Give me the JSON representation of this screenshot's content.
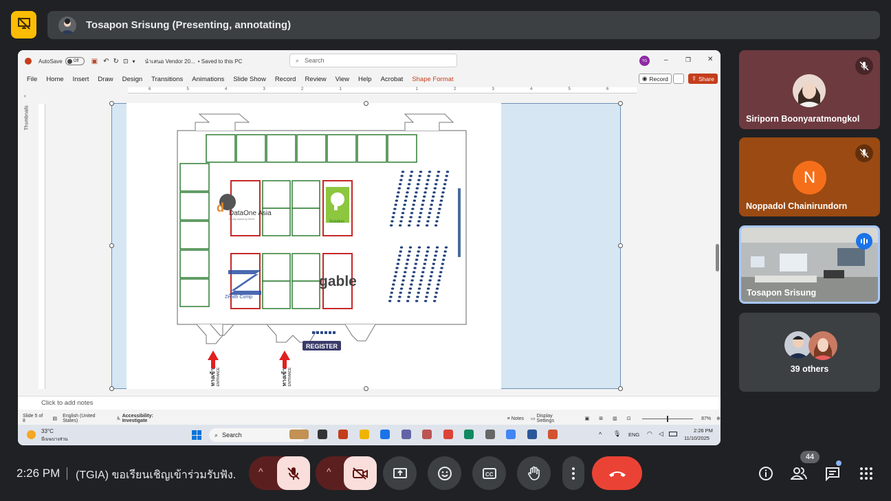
{
  "presenter": {
    "label": "Tosapon Srisung (Presenting, annotating)"
  },
  "ppt": {
    "autosave": "AutoSave",
    "autosave_state": "Off",
    "filename": "นำเสนอ Vendor 20...",
    "saved": "• Saved to this PC",
    "search_placeholder": "Search",
    "user_initials": "TG",
    "menu": [
      "File",
      "Home",
      "Insert",
      "Draw",
      "Design",
      "Transitions",
      "Animations",
      "Slide Show",
      "Record",
      "Review",
      "View",
      "Help",
      "Acrobat",
      "Shape Format"
    ],
    "record_label": "Record",
    "share_label": "Share",
    "thumbnails_label": "Thumbnails",
    "notes_placeholder": "Click to add notes",
    "status": {
      "slide": "Slide 5 of 8",
      "language": "English (United States)",
      "accessibility": "Accessibility: Investigate",
      "notes": "Notes",
      "display": "Display Settings",
      "zoom": "87%"
    },
    "taskbar": {
      "weather_temp": "33°C",
      "weather_desc": "มีเมฆบางส่วน",
      "search": "Search",
      "lang": "ENG",
      "time": "2:26 PM",
      "date": "11/10/2025"
    }
  },
  "slide": {
    "logos": {
      "dataone": "DataOne Asia",
      "dataone_sub": "Wholly owned by SUGA",
      "solution": "Solution",
      "zenith": "Zenith Comp",
      "gable": "gable",
      "register": "REGISTER",
      "entrance_th": "ทางเข้า",
      "entrance_en": "ENTRANCE"
    }
  },
  "participants": [
    {
      "name": "Siriporn Boonyaratmongkol",
      "bg": "#6d3a3f",
      "muted": true
    },
    {
      "name": "Noppadol Chainirundorn",
      "bg": "#9a4a12",
      "initial": "N",
      "muted": true
    },
    {
      "name": "Tosapon Srisung",
      "speaking": true
    },
    {
      "name": "39 others"
    }
  ],
  "bottombar": {
    "time": "2:26 PM",
    "meeting_title": "(TGIA) ขอเรียนเชิญเข้าร่วมรับฟัง...",
    "people_count": "44"
  },
  "colors": {
    "end_call": "#ea4335",
    "muted_btn": "#f9dedc",
    "accent": "#8ab4f8"
  }
}
